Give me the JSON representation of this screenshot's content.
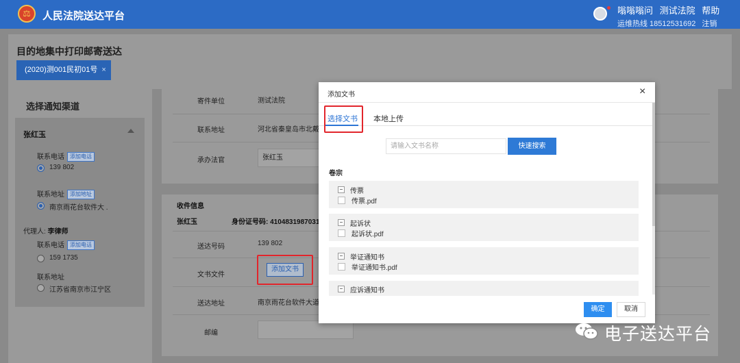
{
  "header": {
    "app_title": "人民法院送达平台",
    "logo_glyph": "⚖",
    "user_name": "嗡嗡嗡问",
    "court": "测试法院",
    "help": "帮助",
    "hotline": "运维热线 18512531692",
    "logout": "注销",
    "brand_color": "#2c6bc5"
  },
  "page": {
    "title": "目的地集中打印邮寄送达",
    "case_tab": "(2020)测001民初01号",
    "case_tab_close": "×"
  },
  "left": {
    "channel_title": "选择通知渠道",
    "party_name": "张红玉",
    "phone_label": "联系电话",
    "add_phone": "添加电话",
    "phone_value": "139        802",
    "address_label": "联系地址",
    "add_address": "添加地址",
    "address_value": "南京雨花台软件大           .",
    "agent_label": "代理人:",
    "agent_name": "李律师",
    "agent_phone_label": "联系电话",
    "agent_add_phone": "添加电话",
    "agent_phone_value": "159            1735",
    "agent_address_label": "联系地址",
    "agent_address_value": "江苏省南京市江宁区"
  },
  "sender": {
    "unit_label": "寄件单位",
    "unit_value": "测试法院",
    "address_label": "联系地址",
    "address_value": "河北省秦皇岛市北戴",
    "judge_label": "承办法官",
    "judge_value": "张红玉"
  },
  "receiver": {
    "title": "收件信息",
    "name": "张红玉",
    "id_label": "身份证号码: 4104831987031",
    "number_label": "送达号码",
    "number_value": "139        802",
    "doc_label": "文书文件",
    "add_doc": "添加文书",
    "address_label": "送达地址",
    "address_value": "南京雨花台软件大道",
    "zip_label": "邮编",
    "zip_value": ""
  },
  "modal": {
    "title": "添加文书",
    "close": "×",
    "tab_select": "选择文书",
    "tab_upload": "本地上传",
    "search_placeholder": "请输入文书名称",
    "search_button": "快速搜索",
    "section": "卷宗",
    "groups": [
      {
        "name": "传票",
        "file": "传票.pdf"
      },
      {
        "name": "起诉状",
        "file": "起诉状.pdf"
      },
      {
        "name": "举证通知书",
        "file": "举证通知书.pdf"
      },
      {
        "name": "应诉通知书",
        "file": ""
      }
    ],
    "ok": "确定",
    "cancel": "取消",
    "accent_color": "#2b74d5"
  },
  "watermark": {
    "text": "电子送达平台"
  }
}
